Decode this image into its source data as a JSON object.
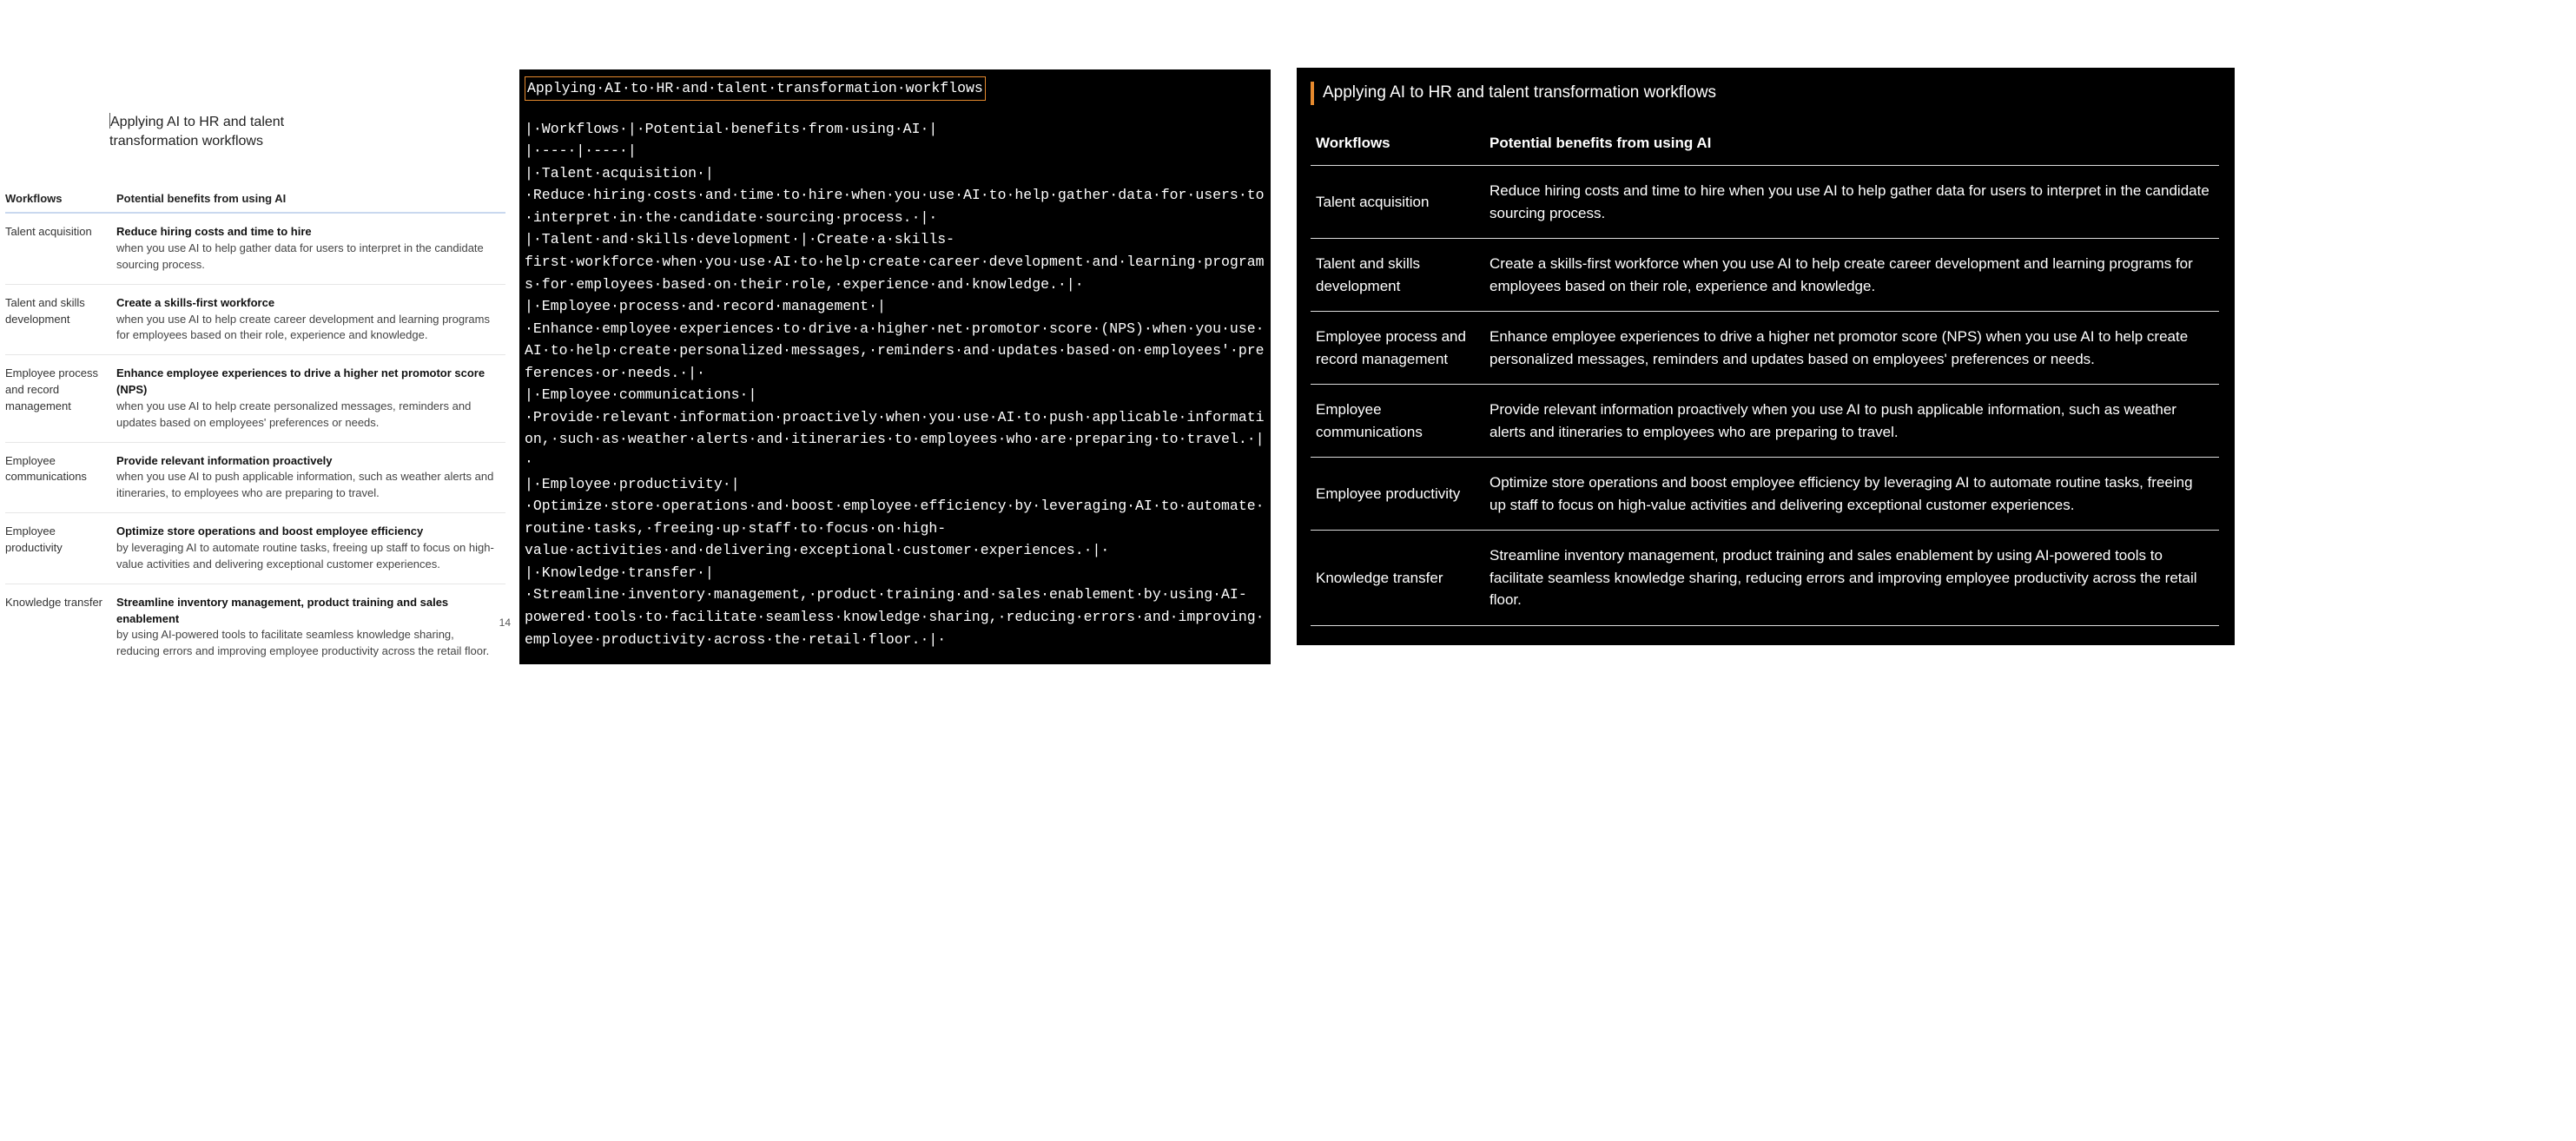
{
  "title": "Applying AI to HR and talent transformation workflows",
  "light_title_line1": "Applying AI to HR and talent",
  "light_title_line2": "transformation workflows",
  "page_number": "14",
  "columns": {
    "workflows": "Workflows",
    "benefits": "Potential benefits from using AI"
  },
  "rows": [
    {
      "workflow": "Talent acquisition",
      "lead": "Reduce hiring costs and time to hire",
      "body": "when you use AI to help gather data for users to interpret in the candidate sourcing process.",
      "combined": "Reduce hiring costs and time to hire when you use AI to help gather data for users to interpret in the candidate sourcing process."
    },
    {
      "workflow": "Talent and skills development",
      "lead": "Create a skills-first workforce",
      "body": "when you use AI to help create career development and learning programs for employees based on their role, experience and knowledge.",
      "combined": "Create a skills-first workforce when you use AI to help create career development and learning programs for employees based on their role, experience and knowledge."
    },
    {
      "workflow": "Employee process and record management",
      "lead": "Enhance employee experiences to drive a higher net promotor score (NPS)",
      "body": "when you use AI to help create personalized messages, reminders and updates based on employees' preferences or needs.",
      "combined": "Enhance employee experiences to drive a higher net promotor score (NPS) when you use AI to help create personalized messages, reminders and updates based on employees' preferences or needs."
    },
    {
      "workflow": "Employee communications",
      "lead": "Provide relevant information proactively",
      "body": "when you use AI to push applicable information, such as weather alerts and itineraries, to employees who are preparing to travel.",
      "combined": "Provide relevant information proactively when you use AI to push applicable information, such as weather alerts and itineraries to employees who are preparing to travel."
    },
    {
      "workflow": "Employee productivity",
      "lead": "Optimize store operations and boost employee efficiency",
      "body": "by leveraging AI to automate routine tasks, freeing up staff to focus on high-value activities and delivering exceptional customer experiences.",
      "combined": "Optimize store operations and boost employee efficiency by leveraging AI to automate routine tasks, freeing up staff to focus on high-value activities and delivering exceptional customer experiences."
    },
    {
      "workflow": "Knowledge transfer",
      "lead": "Streamline inventory management, product training and sales enablement",
      "body": "by using AI-powered tools to facilitate seamless knowledge sharing, reducing errors and improving employee productivity across the retail floor.",
      "combined": "Streamline inventory management, product training and sales enablement by using AI-powered tools to facilitate seamless knowledge sharing, reducing errors and improving employee productivity across the retail floor."
    }
  ],
  "markdown_sep": "| --- | --- |"
}
